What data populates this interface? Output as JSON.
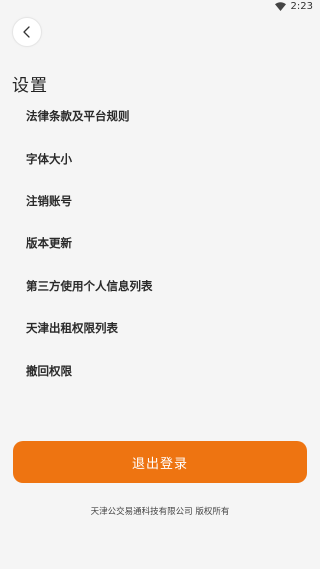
{
  "status_bar": {
    "time": "2:23",
    "icons": [
      "wifi-icon"
    ]
  },
  "header": {
    "back_icon": "chevron-left-icon",
    "title": "设置"
  },
  "menu": {
    "items": [
      {
        "label": "法律条款及平台规则"
      },
      {
        "label": "字体大小"
      },
      {
        "label": "注销账号"
      },
      {
        "label": "版本更新"
      },
      {
        "label": "第三方使用个人信息列表"
      },
      {
        "label": "天津出租权限列表"
      },
      {
        "label": "撤回权限"
      }
    ]
  },
  "logout": {
    "label": "退出登录"
  },
  "footer": {
    "copyright": "天津公交易通科技有限公司 版权所有"
  },
  "colors": {
    "accent": "#ee7411",
    "background": "#f5f5f5"
  }
}
